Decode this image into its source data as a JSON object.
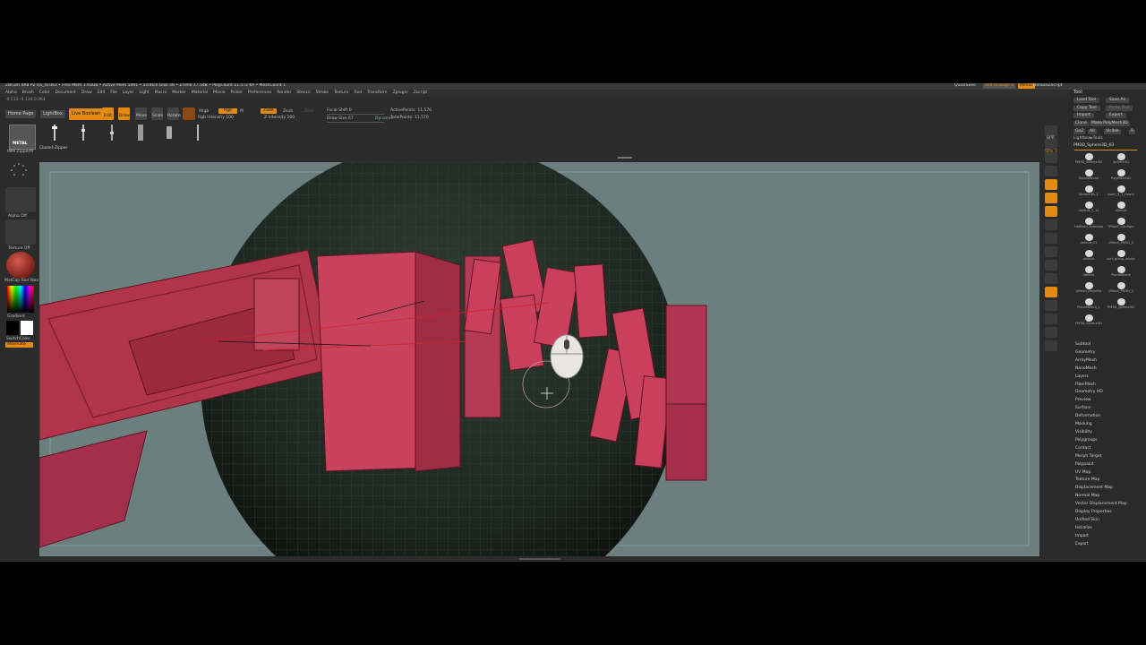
{
  "titlebar": {
    "title": "ZBrush 4R8 P2   QS_41063  • Free Mem 3.93GB • Active Mem 5491 • Scratch Disk 48 • ZTime 17.548 • PolyCount 11.572 KP • MeshCount 1",
    "quicksave": "QuickSave",
    "seethrough": "See-through 0",
    "menus": "Menus",
    "default_script": "DefaultZScript"
  },
  "menubar": {
    "items": [
      "Alpha",
      "Brush",
      "Color",
      "Document",
      "Draw",
      "Edit",
      "File",
      "Layer",
      "Light",
      "Macro",
      "Marker",
      "Material",
      "Movie",
      "Picker",
      "Preferences",
      "Render",
      "Stencil",
      "Stroke",
      "Texture",
      "Tool",
      "Transform",
      "Zplugin",
      "Zscript"
    ]
  },
  "coords": "-0.513,-0.134,0.964",
  "shelf": {
    "home_page": "Home Page",
    "lightbox": "LightBox",
    "live_boolean": "Live Boolean",
    "edit": "Edit",
    "draw": "Draw",
    "move": "Move",
    "scale": "Scale",
    "rotate": "Rotate",
    "mrgb": "Mrgb",
    "rgb": "Rgb",
    "m": "M",
    "rgb_intensity": "Rgb Intensity 100",
    "zadd": "Zadd",
    "zsub": "Zsub",
    "zcut": "Zcut",
    "z_intensity": "Z Intensity 100",
    "focal_shift": "Focal Shift 0",
    "draw_size": "Draw Size 67",
    "dynamic": "Dynamic",
    "active_points": "ActivePoints: 11,570",
    "total_points": "TotalPoints: 11,570"
  },
  "brushes": {
    "current_label": "IMM ZipperM",
    "selected": "Closed-Zipper",
    "metal_label": "METAL"
  },
  "leftpanel": {
    "alpha": "Alpha Off",
    "texture": "Texture Off",
    "material": "MatCap Red Wax",
    "gradient": "Gradient",
    "switch": "SwitchColor",
    "alternate": "Alternate"
  },
  "rightshelf": {
    "bpr": "BPR",
    "spix": "SPix 3"
  },
  "toolpanel": {
    "header": "Tool",
    "load_tool": "Load Tool",
    "save_as": "Save As",
    "copy_tool": "Copy Tool",
    "paste_tool": "Paste Tool",
    "import": "Import",
    "export": "Export",
    "clone": "Clone",
    "make_polymesh": "Make PolyMesh3D",
    "goz": "GoZ",
    "all": "All",
    "visible": "Visible",
    "r": "R",
    "lightbox_tools": "Lightbox▸Tools",
    "current_tool": "PM3D_Sphere3D_63",
    "thumbs": [
      "PM3D_Sphere3D",
      "Sphere3D",
      "SimpleBrush",
      "PolyMesh3D",
      "Sphere3D_1",
      "open_3_T_Home",
      "default_1_12",
      "default",
      "HatMain_Eyebrow",
      "TPoseT_Configur",
      "default_01",
      "UMesh_PM3D_S",
      "default",
      "surf_group_whole",
      "default",
      "PlaneMesh4",
      "UMesh_PlaneMe",
      "UMesh_PM3D_S",
      "PlaneMesh4_1",
      "PM3D_Sphere3D",
      "PM3D_Sphere3D"
    ],
    "sections": [
      "Subtool",
      "Geometry",
      "ArrayMesh",
      "NanoMesh",
      "Layers",
      "FiberMesh",
      "Geometry HD",
      "Preview",
      "Surface",
      "Deformation",
      "Masking",
      "Visibility",
      "Polygroups",
      "Contact",
      "Morph Target",
      "Polypaint",
      "UV Map",
      "Texture Map",
      "Displacement Map",
      "Normal Map",
      "Vector Displacement Map",
      "Display Properties",
      "Unified Skin",
      "Initialize",
      "Import",
      "Export"
    ]
  },
  "colors": {
    "accent": "#e38a14",
    "viewport_bg": "#6b7f7f",
    "mesh_red": "#b0354a",
    "panel_bg": "#2b2b2b"
  }
}
